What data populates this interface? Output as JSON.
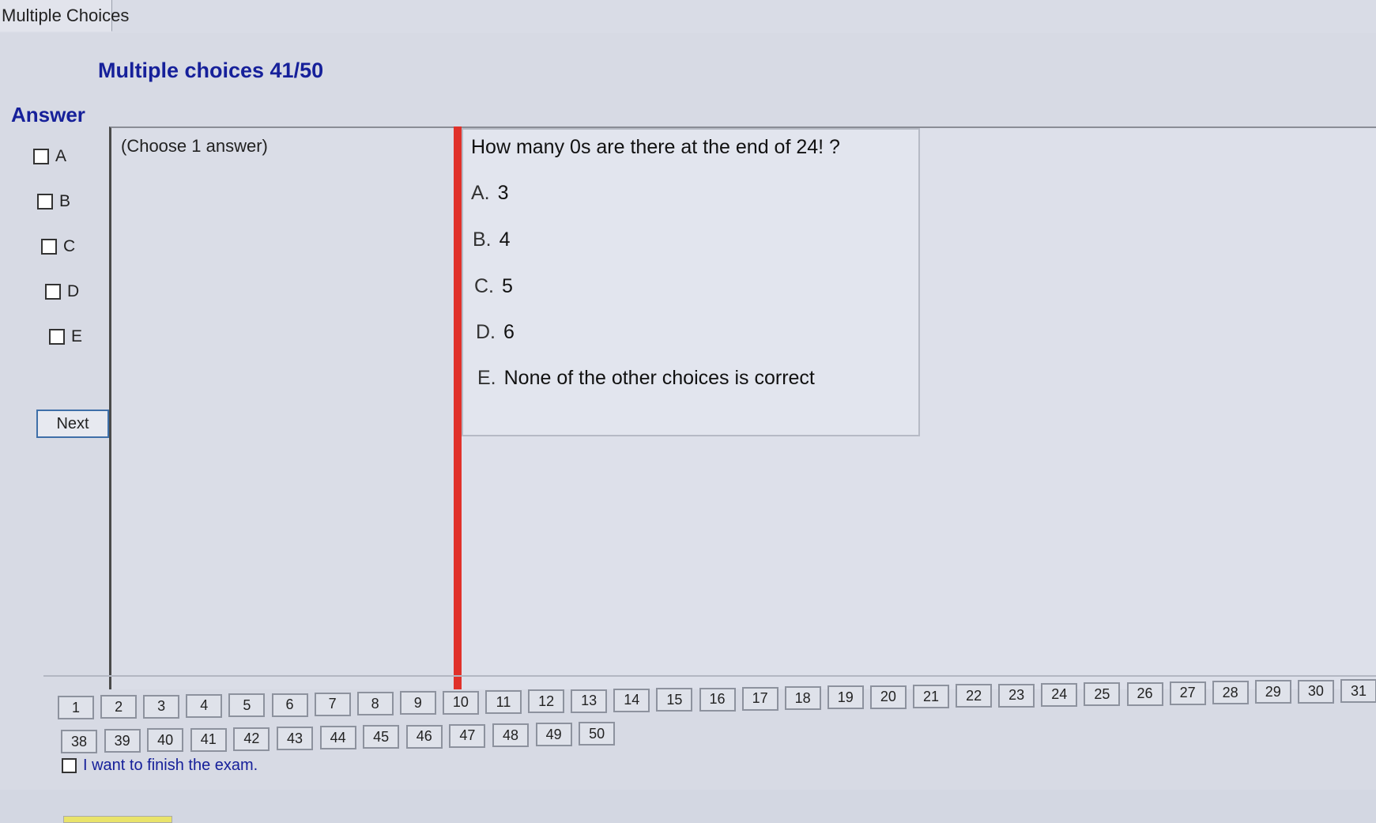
{
  "window": {
    "tab_label": "Multiple Choices"
  },
  "header": {
    "title": "Multiple choices 41/50"
  },
  "answer_panel": {
    "label": "Answer",
    "choices": [
      "A",
      "B",
      "C",
      "D",
      "E"
    ],
    "next_label": "Next"
  },
  "instruction": "(Choose 1 answer)",
  "question": {
    "text": "How many 0s are there at the end of 24! ?",
    "options": [
      {
        "letter": "A.",
        "text": "3"
      },
      {
        "letter": "B.",
        "text": "4"
      },
      {
        "letter": "C.",
        "text": "5"
      },
      {
        "letter": "D.",
        "text": "6"
      },
      {
        "letter": "E.",
        "text": "None of the other choices is correct"
      }
    ]
  },
  "navigation": {
    "row1": [
      "1",
      "2",
      "3",
      "4",
      "5",
      "6",
      "7",
      "8",
      "9",
      "10",
      "11",
      "12",
      "13",
      "14",
      "15",
      "16",
      "17",
      "18",
      "19",
      "20",
      "21",
      "22",
      "23",
      "24",
      "25",
      "26",
      "27",
      "28",
      "29",
      "30",
      "31"
    ],
    "row2": [
      "38",
      "39",
      "40",
      "41",
      "42",
      "43",
      "44",
      "45",
      "46",
      "47",
      "48",
      "49",
      "50"
    ],
    "finish_label": "I want to finish the exam."
  },
  "colors": {
    "accent_blue": "#16209a",
    "splitter_red": "#e0312a"
  }
}
